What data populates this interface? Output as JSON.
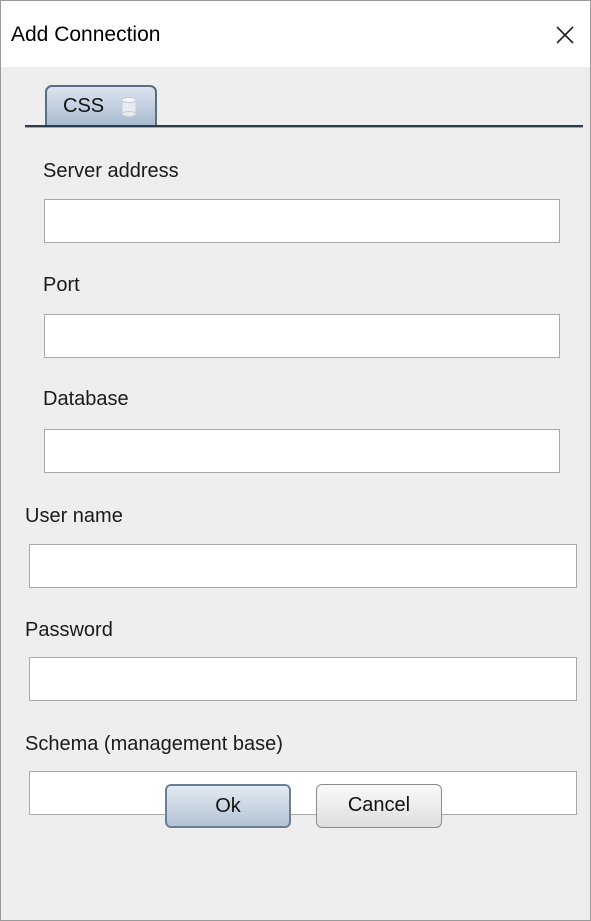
{
  "window": {
    "title": "Add Connection"
  },
  "tabs": [
    {
      "label": "CSS",
      "icon": "database-icon",
      "selected": true
    }
  ],
  "form": {
    "server_address": {
      "label": "Server address",
      "value": ""
    },
    "port": {
      "label": "Port",
      "value": ""
    },
    "database": {
      "label": "Database",
      "value": ""
    },
    "user_name": {
      "label": "User name",
      "value": ""
    },
    "password": {
      "label": "Password",
      "value": ""
    },
    "schema": {
      "label": "Schema (management base)",
      "value": ""
    }
  },
  "buttons": {
    "ok_label": "Ok",
    "cancel_label": "Cancel"
  },
  "colors": {
    "tab_accent": "#a9bbcf",
    "ok_accent": "#b3c3d6"
  }
}
